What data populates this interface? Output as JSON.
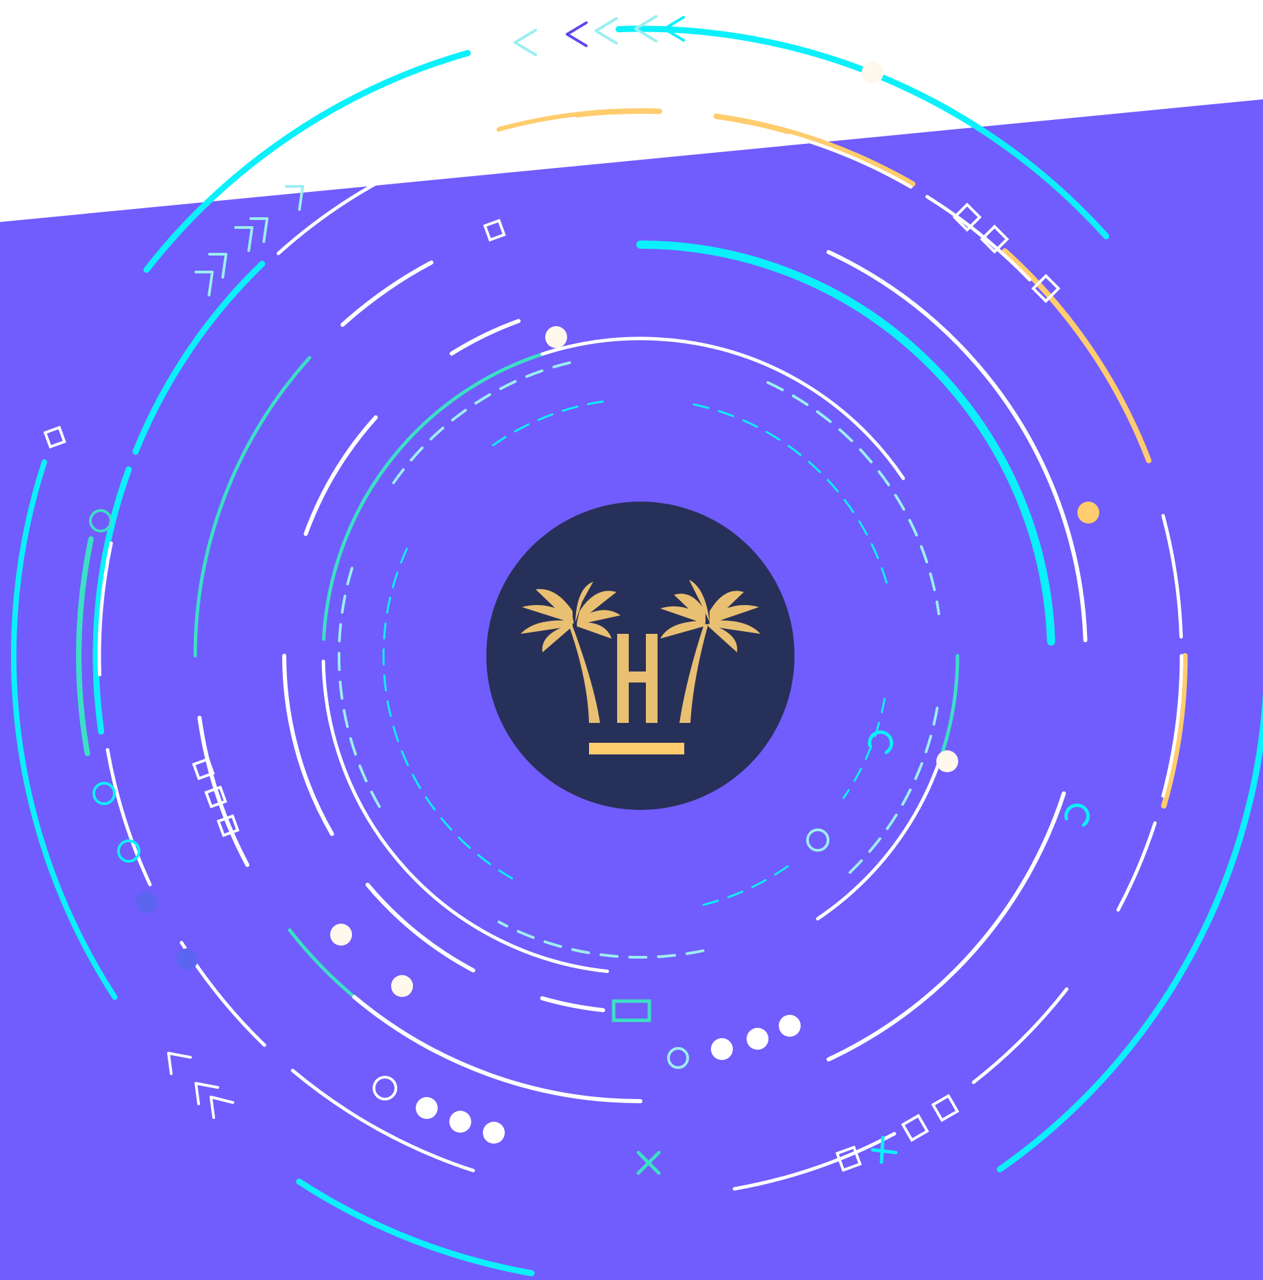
{
  "colors": {
    "sky": "#ffffff",
    "ground": "#715cfd",
    "cyan": "#0cf0fb",
    "teal": "#3be0c5",
    "white": "#ffffff",
    "gold": "#ffcc6e",
    "mint": "#9beef0",
    "navy": "#273058",
    "palm": "#e9bf72",
    "violet": "#5c47f0"
  },
  "emblem": {
    "icon": "palm-trees-icon",
    "letter": "H"
  }
}
